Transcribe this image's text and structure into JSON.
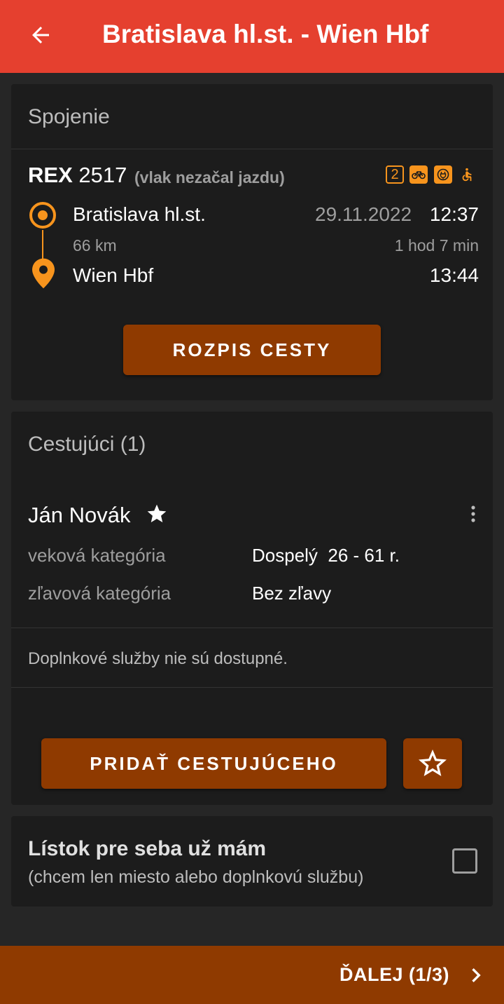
{
  "appbar": {
    "title": "Bratislava hl.st. - Wien Hbf",
    "back_icon": "arrow-left-icon"
  },
  "connection": {
    "header": "Spojenie",
    "train_type": "REX",
    "train_number": "2517",
    "status": "(vlak nezačal jazdu)",
    "class_badge": "2",
    "amenity_icons": [
      "second-class-icon",
      "bicycle-icon",
      "power-socket-icon",
      "wheelchair-icon"
    ],
    "from_station": "Bratislava hl.st.",
    "date": "29.11.2022",
    "departure_time": "12:37",
    "distance": "66 km",
    "duration": "1 hod 7 min",
    "to_station": "Wien Hbf",
    "arrival_time": "13:44",
    "details_button": "ROZPIS CESTY"
  },
  "passengers": {
    "header": "Cestujúci (1)",
    "passenger": {
      "name": "Ján Novák",
      "age_label": "veková kategória",
      "age_value": "Dospelý  26 - 61 r.",
      "discount_label": "zľavová kategória",
      "discount_value": "Bez zľavy"
    },
    "services_note": "Doplnkové služby nie sú dostupné.",
    "add_button": "PRIDAŤ CESTUJÚCEHO"
  },
  "own_ticket": {
    "title": "Lístok pre seba už mám",
    "subtitle": "(chcem len miesto alebo doplnkovú službu)",
    "checked": false
  },
  "bottom": {
    "next_label": "ĎALEJ (1/3)"
  },
  "colors": {
    "appbar": "#e5402f",
    "accent": "#f7941d",
    "button": "#8f3a00",
    "card": "#1c1c1c",
    "background": "#262626"
  }
}
